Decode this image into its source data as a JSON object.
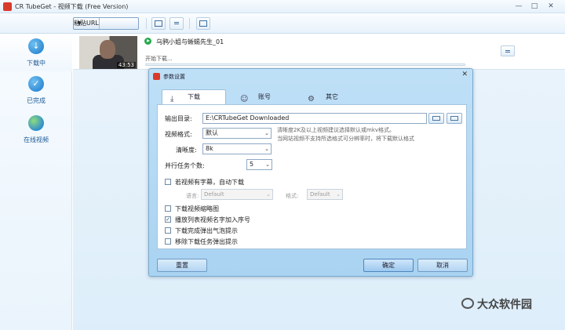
{
  "window": {
    "title": "CR TubeGet - 视频下载 (Free Version)",
    "controls": [
      "—",
      "□",
      "✕"
    ]
  },
  "toolbar": {
    "paste_url_label": "粘贴URL",
    "icons": [
      "batch-download-icon",
      "download-settings-icon",
      "window-icon"
    ]
  },
  "sidebar": {
    "items": [
      {
        "label": "下载中",
        "icon": "download-icon"
      },
      {
        "label": "已完成",
        "icon": "check-icon"
      },
      {
        "label": "在线视频",
        "icon": "globe-icon"
      }
    ]
  },
  "download_list": {
    "items": [
      {
        "title": "乌鸦小姐与蜥蜴先生_01",
        "duration": "43:53",
        "status": "开始下载...",
        "progress": 0
      }
    ]
  },
  "dialog": {
    "title": "参数设置",
    "close": "✕",
    "tabs": [
      {
        "label": "下载",
        "icon": "download-icon",
        "active": true
      },
      {
        "label": "账号",
        "icon": "user-icon",
        "active": false
      },
      {
        "label": "其它",
        "icon": "gear-icon",
        "active": false
      }
    ],
    "output_dir": {
      "label": "输出目录:",
      "value": "E:\\CRTubeGet Downloaded"
    },
    "video_format": {
      "label": "视频格式:",
      "value": "默认"
    },
    "format_hint_1": "清晰度2K及以上视频建议选择默认或mkv格式。",
    "format_hint_2": "当网站视频不支持所选格式可分辨率时，将下载默认格式",
    "quality": {
      "label": "清晰度:",
      "value": "8k"
    },
    "parallel_tasks": {
      "label": "并行任务个数:",
      "value": "5"
    },
    "subtitle_option": {
      "label": "若视频有字幕，自动下载",
      "checked": false
    },
    "language": {
      "label": "语言:",
      "value": "Default"
    },
    "subtitle_format": {
      "label": "格式:",
      "value": "Default"
    },
    "options": [
      {
        "label": "下载视频缩略图",
        "checked": false
      },
      {
        "label": "播放列表视频名字加入序号",
        "checked": true
      },
      {
        "label": "下载完成弹出气泡提示",
        "checked": false
      },
      {
        "label": "移除下载任务弹出提示",
        "checked": false
      }
    ],
    "buttons": {
      "reset": "重置",
      "ok": "确定",
      "cancel": "取消"
    }
  },
  "watermark": {
    "text": "大众软件园"
  }
}
